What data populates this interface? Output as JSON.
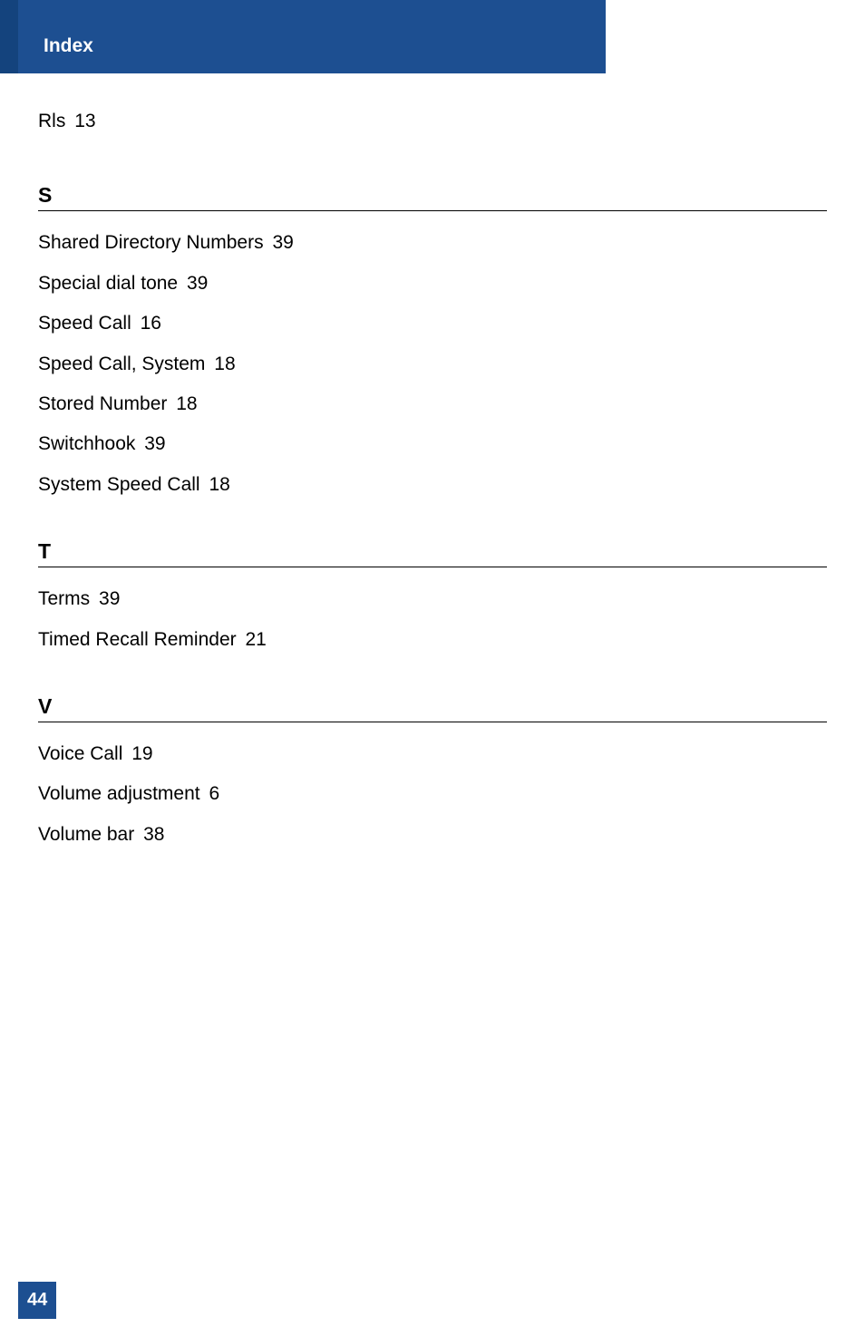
{
  "header": {
    "title": "Index"
  },
  "entries": {
    "r": [
      {
        "term": "Rls",
        "page": "13"
      }
    ],
    "s_heading": "S",
    "s": [
      {
        "term": "Shared Directory Numbers",
        "page": "39"
      },
      {
        "term": "Special dial tone",
        "page": "39"
      },
      {
        "term": "Speed Call",
        "page": "16"
      },
      {
        "term": "Speed Call, System",
        "page": "18"
      },
      {
        "term": "Stored Number",
        "page": "18"
      },
      {
        "term": "Switchhook",
        "page": "39"
      },
      {
        "term": "System Speed Call",
        "page": "18"
      }
    ],
    "t_heading": "T",
    "t": [
      {
        "term": "Terms",
        "page": "39"
      },
      {
        "term": "Timed Recall Reminder",
        "page": "21"
      }
    ],
    "v_heading": "V",
    "v": [
      {
        "term": "Voice Call",
        "page": "19"
      },
      {
        "term": "Volume adjustment",
        "page": "6"
      },
      {
        "term": "Volume bar",
        "page": "38"
      }
    ]
  },
  "page_number": "44"
}
